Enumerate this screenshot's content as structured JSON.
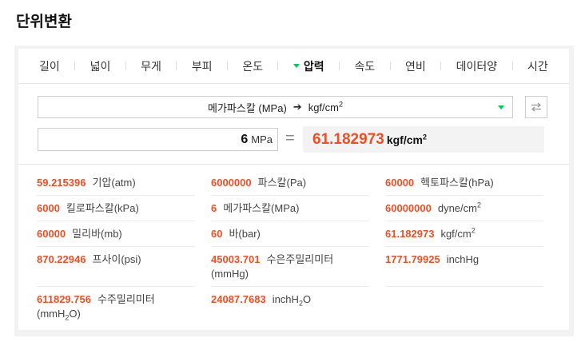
{
  "page_title": "단위변환",
  "tabs": [
    {
      "label": "길이"
    },
    {
      "label": "넓이"
    },
    {
      "label": "무게"
    },
    {
      "label": "부피"
    },
    {
      "label": "온도"
    },
    {
      "label": "압력"
    },
    {
      "label": "속도"
    },
    {
      "label": "연비"
    },
    {
      "label": "데이터양"
    },
    {
      "label": "시간"
    }
  ],
  "active_tab": "압력",
  "converter": {
    "from_unit": "메가파스칼 (MPa)",
    "to_unit_base": "kgf/cm",
    "to_unit_sup": "2",
    "input_value": "6",
    "input_unit": "MPa",
    "equals": "=",
    "result_value": "61.182973",
    "result_unit_base": "kgf/cm",
    "result_unit_sup": "2"
  },
  "results": [
    [
      {
        "value": "59.215396",
        "name": "기압(atm)"
      },
      {
        "value": "6000000",
        "name": "파스칼(Pa)"
      },
      {
        "value": "60000",
        "name": "헥토파스칼(hPa)"
      }
    ],
    [
      {
        "value": "6000",
        "name": "킬로파스칼(kPa)"
      },
      {
        "value": "6",
        "name": "메가파스칼(MPa)"
      },
      {
        "value": "60000000",
        "name": "dyne/cm",
        "sup": "2"
      }
    ],
    [
      {
        "value": "60000",
        "name": "밀리바(mb)"
      },
      {
        "value": "60",
        "name": "바(bar)"
      },
      {
        "value": "61.182973",
        "name": "kgf/cm",
        "sup": "2"
      }
    ],
    [
      {
        "value": "870.22946",
        "name": "프사이(psi)"
      },
      {
        "value": "45003.701",
        "name": "수은주밀리미터",
        "name2": "(mmHg)"
      },
      {
        "value": "1771.79925",
        "name": "inchHg"
      }
    ],
    [
      {
        "value": "611829.756",
        "name": "수주밀리미터",
        "name2_pre": "(mmH",
        "name2_sub": "2",
        "name2_post": "O)"
      },
      {
        "value": "24087.7683",
        "name": "inchH",
        "sub": "2",
        "post": "O"
      },
      null
    ]
  ],
  "colors": {
    "accent": "#03c75a",
    "value": "#f04e23"
  }
}
